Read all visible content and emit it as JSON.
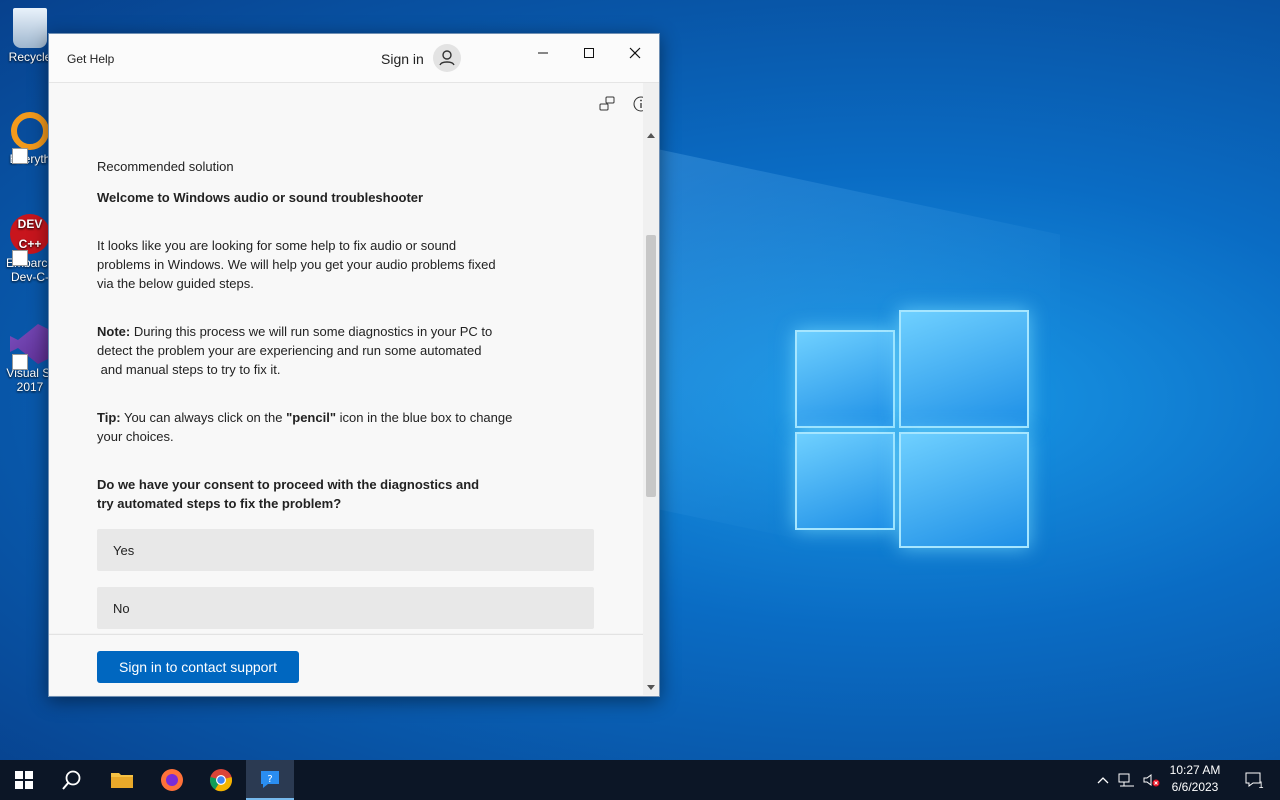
{
  "desktop": {
    "icons": [
      {
        "label": "Recycle"
      },
      {
        "label": "Everyth"
      },
      {
        "label": "Embarca Dev-C-"
      },
      {
        "label": "Visual St 2017"
      }
    ]
  },
  "window": {
    "title": "Get Help",
    "signin_label": "Sign in",
    "content": {
      "recommended": "Recommended solution",
      "heading": "Welcome to Windows audio or sound troubleshooter",
      "intro_lines": [
        "It looks like you are looking for some help to fix audio or sound",
        "problems in Windows. We will help you get your audio problems fixed",
        "via the below guided steps."
      ],
      "note_label": "Note:",
      "note_line1": " During this process we will run some diagnostics in your PC to",
      "note_line2": "detect the problem your are experiencing and run some automated",
      "note_line3": " and manual steps to try to fix it.",
      "tip_label": "Tip:",
      "tip_text1": " You can always click on the ",
      "tip_pencil": "\"pencil\"",
      "tip_text2": " icon in the blue box to change",
      "tip_line2": "your choices.",
      "question_line1": "Do we have your consent to proceed with the diagnostics and",
      "question_line2": "try automated steps to fix the problem?",
      "choices": [
        "Yes",
        "No"
      ]
    },
    "footer": {
      "contact_button": "Sign in to contact support"
    }
  },
  "taskbar": {
    "clock_time": "10:27 AM",
    "clock_date": "6/6/2023",
    "notification_count": "1"
  }
}
